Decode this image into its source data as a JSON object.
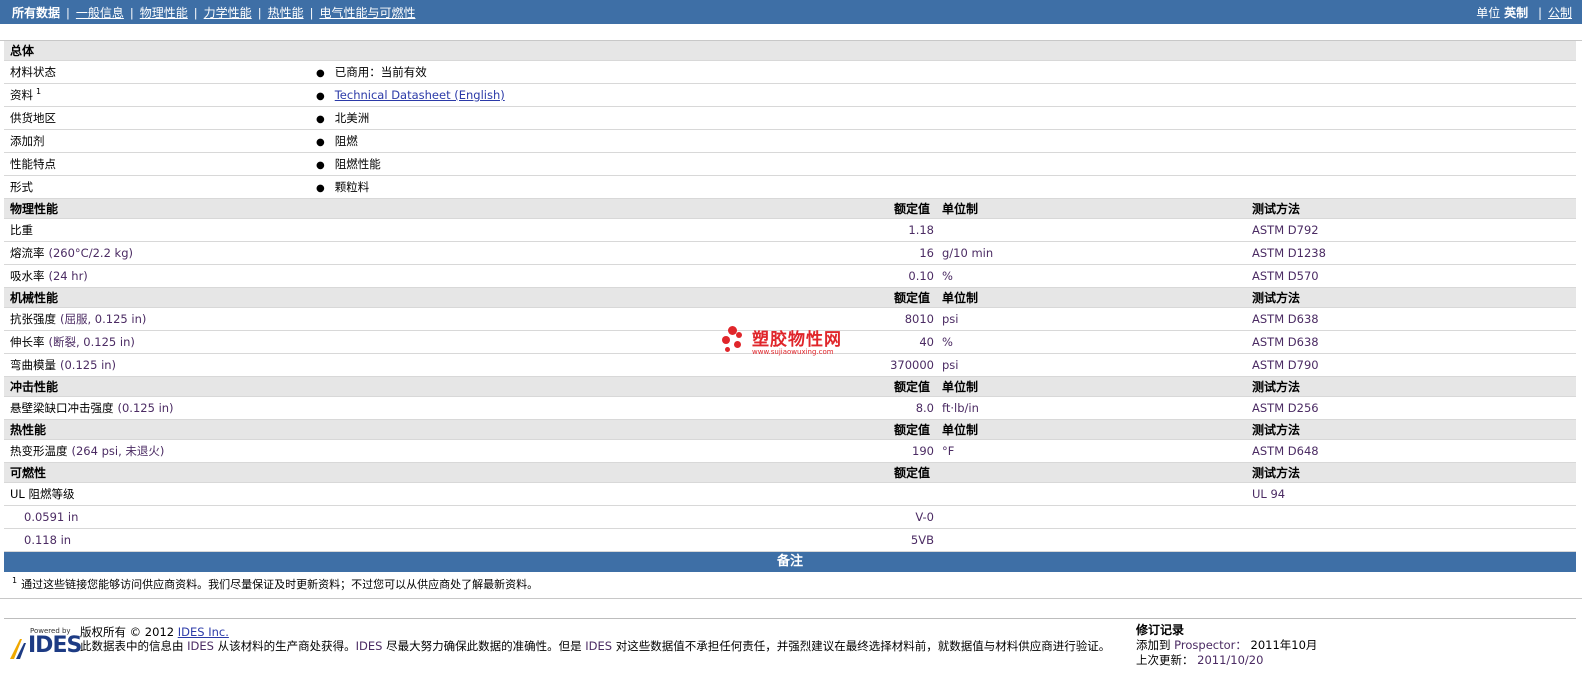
{
  "nav": {
    "tabs": [
      {
        "label": "所有数据",
        "current": true
      },
      {
        "label": "一般信息"
      },
      {
        "label": "物理性能"
      },
      {
        "label": "力学性能"
      },
      {
        "label": "热性能"
      },
      {
        "label": "电气性能与可燃性"
      }
    ],
    "units_label": "单位",
    "unit_english": "英制",
    "unit_metric": "公制"
  },
  "general": {
    "title": "总体",
    "rows": [
      {
        "label": "材料状态",
        "value": "已商用：当前有效"
      },
      {
        "label": "资料",
        "sup": "1",
        "value": "Technical Datasheet (English)",
        "link": true
      },
      {
        "label": "供货地区",
        "value": "北美洲"
      },
      {
        "label": "添加剂",
        "value": "阻燃"
      },
      {
        "label": "性能特点",
        "value": "阻燃性能"
      },
      {
        "label": "形式",
        "value": "颗粒料"
      }
    ]
  },
  "headers": {
    "nominal": "额定值",
    "unit": "单位制",
    "method": "测试方法"
  },
  "sections": [
    {
      "title": "物理性能",
      "show_unit_header": true,
      "rows": [
        {
          "label": "比重",
          "cond": "",
          "value": "1.18",
          "unit": "",
          "method": "ASTM D792"
        },
        {
          "label": "熔流率",
          "cond": "(260°C/2.2 kg)",
          "value": "16",
          "unit": "g/10 min",
          "method": "ASTM D1238"
        },
        {
          "label": "吸水率",
          "cond": "(24 hr)",
          "value": "0.10",
          "unit": "%",
          "method": "ASTM D570"
        }
      ]
    },
    {
      "title": "机械性能",
      "show_unit_header": true,
      "rows": [
        {
          "label": "抗张强度",
          "cond": "(屈服, 0.125 in)",
          "value": "8010",
          "unit": "psi",
          "method": "ASTM D638"
        },
        {
          "label": "伸长率",
          "cond": "(断裂, 0.125 in)",
          "value": "40",
          "unit": "%",
          "method": "ASTM D638"
        },
        {
          "label": "弯曲模量",
          "cond": "(0.125 in)",
          "value": "370000",
          "unit": "psi",
          "method": "ASTM D790"
        }
      ]
    },
    {
      "title": "冲击性能",
      "show_unit_header": true,
      "rows": [
        {
          "label": "悬壁梁缺口冲击强度",
          "cond": "(0.125 in)",
          "value": "8.0",
          "unit": "ft·lb/in",
          "method": "ASTM D256"
        }
      ]
    },
    {
      "title": "热性能",
      "show_unit_header": true,
      "rows": [
        {
          "label": "热变形温度",
          "cond": "(264 psi, 未退火)",
          "value": "190",
          "unit": "°F",
          "method": "ASTM D648"
        }
      ]
    },
    {
      "title": "可燃性",
      "show_unit_header": false,
      "rows": [
        {
          "label": "UL 阻燃等级",
          "cond": "",
          "value": "",
          "unit": "",
          "method": "UL 94"
        },
        {
          "label": "0.0591 in",
          "cond": "",
          "value": "V-0",
          "unit": "",
          "method": "",
          "sub": true
        },
        {
          "label": "0.118 in",
          "cond": "",
          "value": "5VB",
          "unit": "",
          "method": "",
          "sub": true
        }
      ]
    }
  ],
  "notes": {
    "title": "备注",
    "sup": "1",
    "text": "通过这些链接您能够访问供应商资料。我们尽量保证及时更新资料；不过您可以从供应商处了解最新资料。"
  },
  "watermark": {
    "title": "塑胶物性网",
    "url": "www.sujiaowuxing.com"
  },
  "footer": {
    "powered_by": "Powered by",
    "logo_text": "IDES",
    "copyright_prefix": "版权所有 © 2012",
    "copyright_link": "IDES Inc.",
    "disclaimer_1": "此数据表中的信息由",
    "ides": "IDES",
    "disclaimer_2": "从该材料的生产商处获得。",
    "disclaimer_3": "尽最大努力确保此数据的准确性。但是",
    "disclaimer_4": "对这些数据值不承担任何责任，并强烈建议在最终选择材料前，就数据值与材料供应商进行验证。",
    "revision_title": "修订记录",
    "added_label": "添加到",
    "added_target": "Prospector：",
    "added_date": "2011年10月",
    "updated_label": "上次更新：",
    "updated_date": "2011/10/20"
  }
}
